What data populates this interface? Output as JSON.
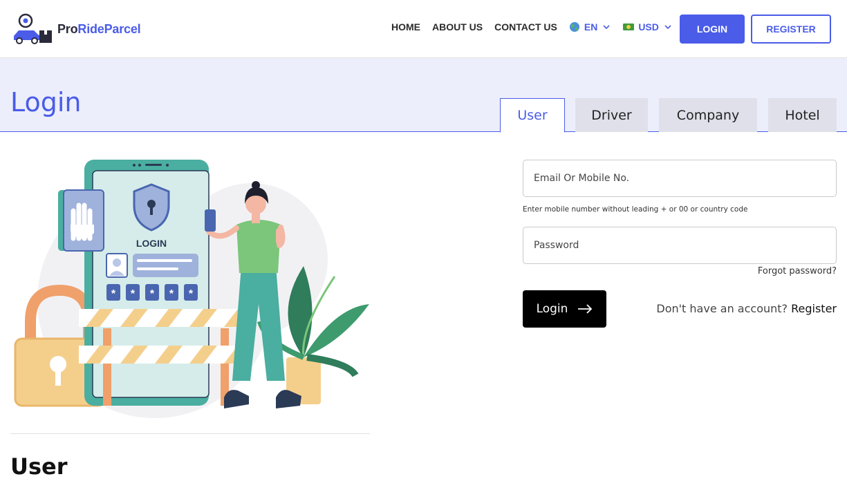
{
  "header": {
    "logo": {
      "pro": "Pro",
      "ride": "RideParcel"
    },
    "nav": [
      "HOME",
      "ABOUT US",
      "CONTACT US"
    ],
    "language": {
      "value": "EN",
      "icon": "globe-icon"
    },
    "currency": {
      "value": "USD",
      "icon": "money-icon"
    },
    "login_label": "LOGIN",
    "register_label": "REGISTER"
  },
  "banner": {
    "title": "Login",
    "tabs": [
      {
        "label": "User",
        "active": true
      },
      {
        "label": "Driver",
        "active": false
      },
      {
        "label": "Company",
        "active": false
      },
      {
        "label": "Hotel",
        "active": false
      }
    ]
  },
  "illustration": {
    "label": "LOGIN",
    "password_chars": [
      "*",
      "*",
      "*",
      "*",
      "*"
    ]
  },
  "section": {
    "title": "User"
  },
  "form": {
    "email_placeholder": "Email Or Mobile No.",
    "email_value": "",
    "hint": "Enter mobile number without leading + or 00 or country code",
    "password_placeholder": "Password",
    "password_value": "",
    "forgot": "Forgot password?",
    "submit": "Login",
    "no_account": "Don't have an account?",
    "register": "Register"
  },
  "colors": {
    "accent": "#4a5ce8",
    "banner_bg": "#eceefb",
    "button_dark": "#000000"
  }
}
